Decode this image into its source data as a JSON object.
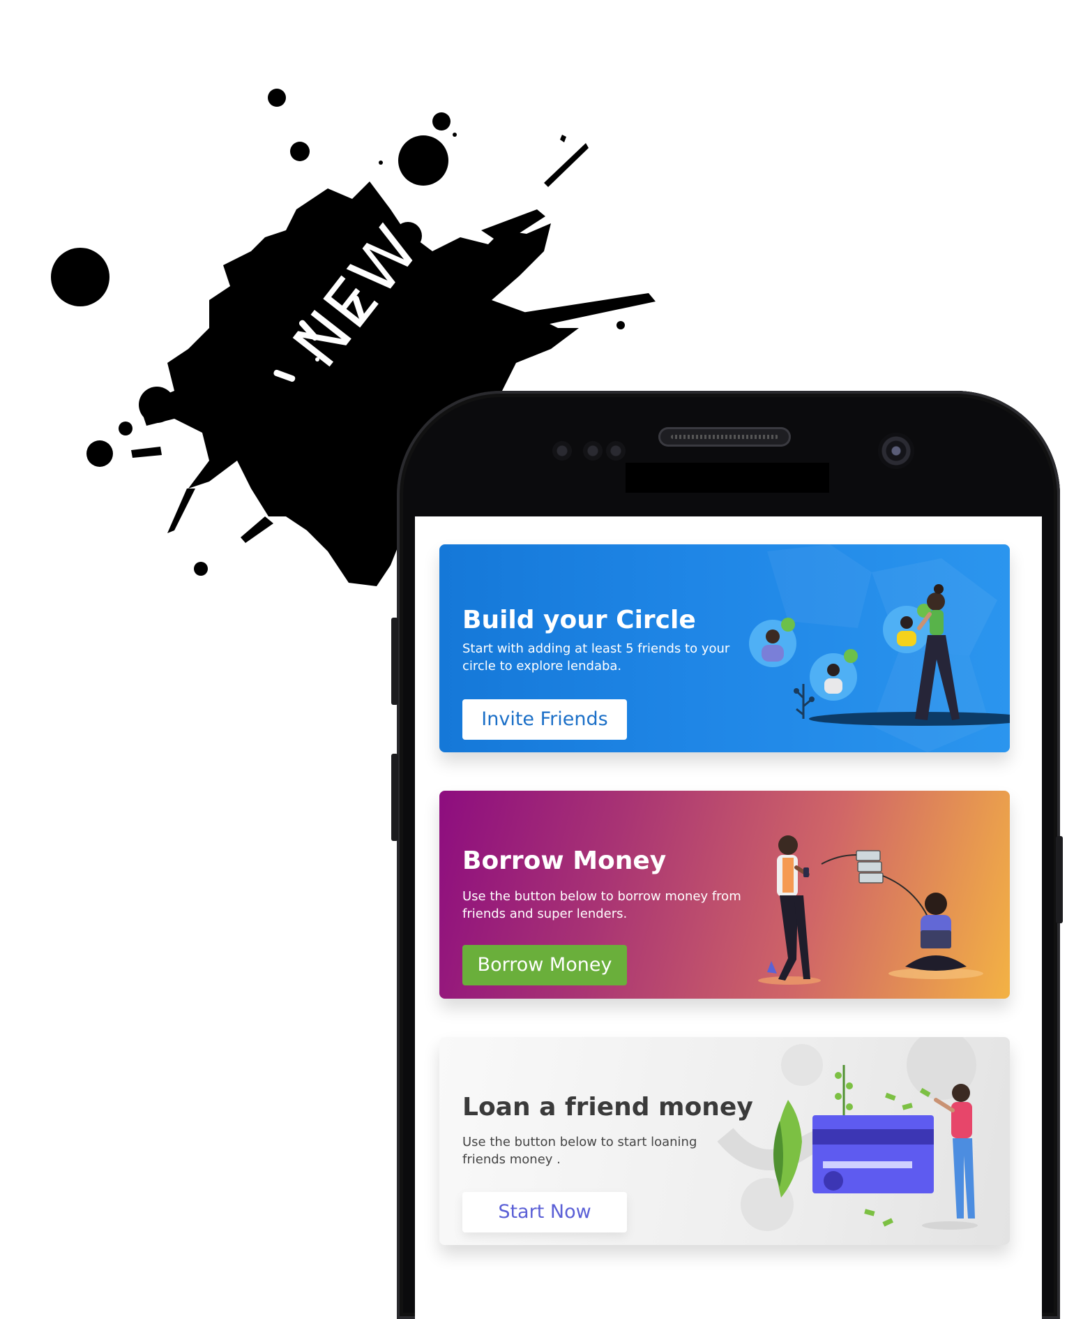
{
  "badge": {
    "text": "NEW"
  },
  "cards": [
    {
      "title": "Build your Circle",
      "description": "Start with adding at least 5 friends to your circle to explore lendaba.",
      "button": "Invite Friends",
      "button_bg": "#ffffff",
      "button_color": "#1b6fc7"
    },
    {
      "title": "Borrow Money",
      "description": "Use the button below to borrow money from friends and super lenders.",
      "button": "Borrow Money",
      "button_bg": "#6aaf3b",
      "button_color": "#ffffff"
    },
    {
      "title": "Loan a friend money",
      "description": "Use the button below to start loaning friends money .",
      "button": "Start Now",
      "button_bg": "#ffffff",
      "button_color": "#5a5fd6"
    }
  ],
  "colors": {
    "circle_card": "#1f86e6",
    "borrow_card_start": "#8d0d7f",
    "borrow_card_end": "#f3b244",
    "loan_card": "#eeeeee",
    "accent_green": "#6aaf3b",
    "splash": "#000000"
  }
}
